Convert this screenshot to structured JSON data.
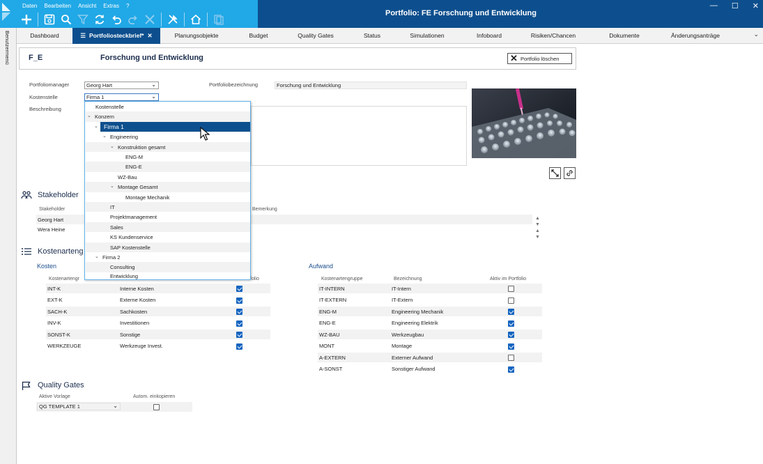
{
  "app": {
    "title": "Portfolio: FE Forschung und Entwicklung",
    "menu": [
      "Daten",
      "Bearbeiten",
      "Ansicht",
      "Extras",
      "?"
    ],
    "window_controls": [
      "—",
      "☐",
      "✕"
    ],
    "side_label": "Benutzermenü"
  },
  "toolbar": {
    "icons": [
      "plus-icon",
      "save-icon",
      "search-icon",
      "filter-icon",
      "refresh-icon",
      "undo-icon",
      "redo-icon",
      "cancel-icon",
      "tools-icon",
      "home-icon",
      "copy-icon"
    ]
  },
  "tabs": [
    {
      "label": "Dashboard",
      "active": false
    },
    {
      "label": "Portfoliosteckbrief*",
      "active": true
    },
    {
      "label": "Planungsobjekte",
      "active": false
    },
    {
      "label": "Budget",
      "active": false
    },
    {
      "label": "Quality Gates",
      "active": false
    },
    {
      "label": "Status",
      "active": false
    },
    {
      "label": "Simulationen",
      "active": false
    },
    {
      "label": "Infoboard",
      "active": false
    },
    {
      "label": "Risiken/Chancen",
      "active": false
    },
    {
      "label": "Dokumente",
      "active": false
    },
    {
      "label": "Änderungsanträge",
      "active": false
    }
  ],
  "header": {
    "code": "F_E",
    "title": "Forschung und Entwicklung",
    "delete_label": "Portfolio löschen"
  },
  "form": {
    "manager_label": "Portfoliomanager",
    "manager_value": "Georg Hart",
    "cost_center_label": "Kostenstelle",
    "cost_center_value": "Firma 1",
    "description_label": "Beschreibung",
    "name_label": "Portfoliobezeichnung",
    "name_value": "Forschung und Entwicklung"
  },
  "dropdown": {
    "header": "Kostenstelle",
    "nodes": [
      {
        "label": "Konzern",
        "level": 0,
        "toggle": "v"
      },
      {
        "label": "Firma 1",
        "level": 1,
        "toggle": "v",
        "selected": true
      },
      {
        "label": "Engineering",
        "level": 2,
        "toggle": "v"
      },
      {
        "label": "Konstruktion gesamt",
        "level": 3,
        "toggle": "v"
      },
      {
        "label": "ENG-M",
        "level": 4,
        "toggle": ""
      },
      {
        "label": "ENG-E",
        "level": 4,
        "toggle": ""
      },
      {
        "label": "WZ-Bau",
        "level": 3,
        "toggle": ""
      },
      {
        "label": "Montage Gesamt",
        "level": 3,
        "toggle": "v"
      },
      {
        "label": "Montage Mechanik",
        "level": 4,
        "toggle": ""
      },
      {
        "label": "IT",
        "level": 2,
        "toggle": ""
      },
      {
        "label": "Projektmanagement",
        "level": 2,
        "toggle": ""
      },
      {
        "label": "Sales",
        "level": 2,
        "toggle": ""
      },
      {
        "label": "KS Kundenservice",
        "level": 2,
        "toggle": ""
      },
      {
        "label": "SAP Kostenstelle",
        "level": 2,
        "toggle": ""
      },
      {
        "label": "Firma 2",
        "level": 1,
        "toggle": "v"
      },
      {
        "label": "Consulting",
        "level": 2,
        "toggle": ""
      },
      {
        "label": "Entwicklung",
        "level": 2,
        "toggle": ""
      }
    ]
  },
  "stakeholder": {
    "title": "Stakeholder",
    "col_stakeholder": "Stakeholder",
    "col_remark": "Bemerkung",
    "rows": [
      "Georg Hart",
      "Wera Heine"
    ]
  },
  "kostenarten": {
    "title": "Kostenartengruppen",
    "title_visible": "Kostenarteng",
    "kosten": {
      "title": "Kosten",
      "col_group": "Kostenartengr",
      "col_active": "folio",
      "rows": [
        {
          "code": "INT-K",
          "name": "Interne Kosten",
          "active": true
        },
        {
          "code": "EXT-K",
          "name": "Externe Kosten",
          "active": true
        },
        {
          "code": "SACH-K",
          "name": "Sachkosten",
          "active": true
        },
        {
          "code": "INV-K",
          "name": "Investitionen",
          "active": true
        },
        {
          "code": "SONST-K",
          "name": "Sonstige",
          "active": true
        },
        {
          "code": "WERKZEUGE",
          "name": "Werkzeuge Invest.",
          "active": true
        }
      ]
    },
    "aufwand": {
      "title": "Aufwand",
      "col_group": "Kostenartengruppe",
      "col_name": "Bezeichnung",
      "col_active": "Aktiv im Portfolio",
      "rows": [
        {
          "code": "IT-INTERN",
          "name": "IT-Intern",
          "active": false
        },
        {
          "code": "IT-EXTERN",
          "name": "IT-Extern",
          "active": false
        },
        {
          "code": "ENG-M",
          "name": "Engineering Mechanik",
          "active": true
        },
        {
          "code": "ENG-E",
          "name": "Engineering Elektrik",
          "active": true
        },
        {
          "code": "WZ-BAU",
          "name": "Werkzeugbau",
          "active": true
        },
        {
          "code": "MONT",
          "name": "Montage",
          "active": true
        },
        {
          "code": "A-EXTERN",
          "name": "Externer Aufwand",
          "active": false
        },
        {
          "code": "A-SONST",
          "name": "Sonstiger Aufwand",
          "active": true
        }
      ]
    }
  },
  "quality_gates": {
    "title": "Quality Gates",
    "col_template": "Aktive Vorlage",
    "col_auto": "Autom. einkopieren",
    "template_value": "QG TEMPLATE 1",
    "auto_copy": false
  },
  "colors": {
    "title_bar": "#0d4f8e",
    "accent_cyan": "#21a8e6",
    "checkbox_on": "#1565c0",
    "selected_node": "#0d4f8e"
  }
}
